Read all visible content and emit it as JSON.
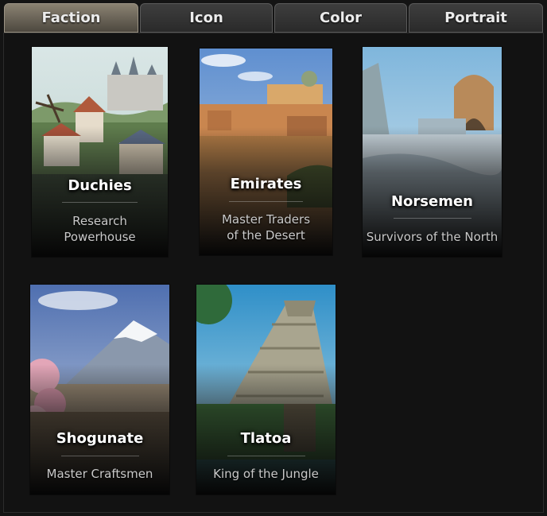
{
  "tabs": [
    {
      "label": "Faction",
      "active": true
    },
    {
      "label": "Icon",
      "active": false
    },
    {
      "label": "Color",
      "active": false
    },
    {
      "label": "Portrait",
      "active": false
    }
  ],
  "factions": [
    {
      "name": "Duchies",
      "description": "Research\nPowerhouse"
    },
    {
      "name": "Emirates",
      "description": "Master Traders\nof the Desert"
    },
    {
      "name": "Norsemen",
      "description": "Survivors of the North"
    },
    {
      "name": "Shogunate",
      "description": "Master Craftsmen"
    },
    {
      "name": "Tlatoa",
      "description": "King of the Jungle"
    }
  ],
  "colors": {
    "active_tab": "#8a8272",
    "inactive_tab": "#333333",
    "background": "#141414"
  }
}
